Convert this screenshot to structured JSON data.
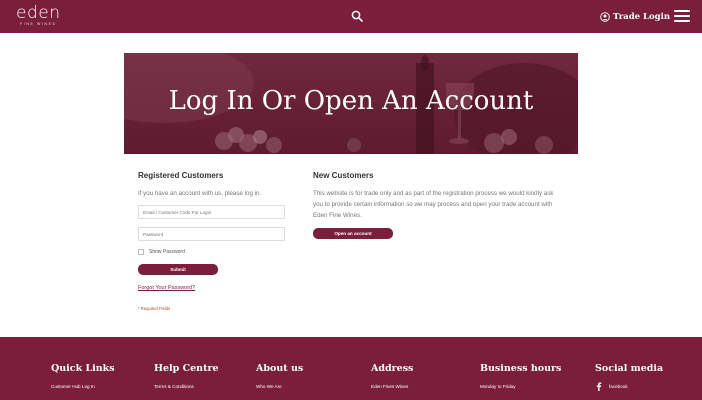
{
  "header": {
    "logo_text": "eden",
    "logo_subtext": "FINE WINES",
    "search_icon": "search-icon",
    "trade_login_label": "Trade Login",
    "user_icon": "user-circle-icon",
    "menu_icon": "hamburger-menu-icon"
  },
  "hero": {
    "title": "Log In Or Open An Account"
  },
  "registered": {
    "heading": "Registered Customers",
    "intro": "If you have an account with us, please log in.",
    "email_placeholder": "Email / Customer Code For Login",
    "password_placeholder": "Password",
    "show_password_label": "Show Password",
    "submit_label": "Submit",
    "forgot_label": "Forgot Your Password?",
    "required_note": "* Required Fields"
  },
  "new_customers": {
    "heading": "New Customers",
    "intro": "This website is for trade only and as part of the registration process we would kindly ask you to provide certain information so we may process and open your trade account with Eden Fine Wines.",
    "open_account_label": "Open an account"
  },
  "footer": {
    "columns": [
      {
        "heading": "Quick Links",
        "links": [
          "Customer Hub Log In"
        ]
      },
      {
        "heading": "Help Centre",
        "links": [
          "Terms & Conditions"
        ]
      },
      {
        "heading": "About us",
        "links": [
          "Who We Are"
        ]
      },
      {
        "heading": "Address",
        "links": [
          "Eden Fines Wines"
        ]
      },
      {
        "heading": "Business hours",
        "links": [
          "Monday to Friday"
        ]
      },
      {
        "heading": "Social media",
        "links": [
          "facebook"
        ]
      }
    ]
  },
  "colors": {
    "brand": "#7a1e3c",
    "hero": "#6a2236",
    "text": "#444444"
  }
}
